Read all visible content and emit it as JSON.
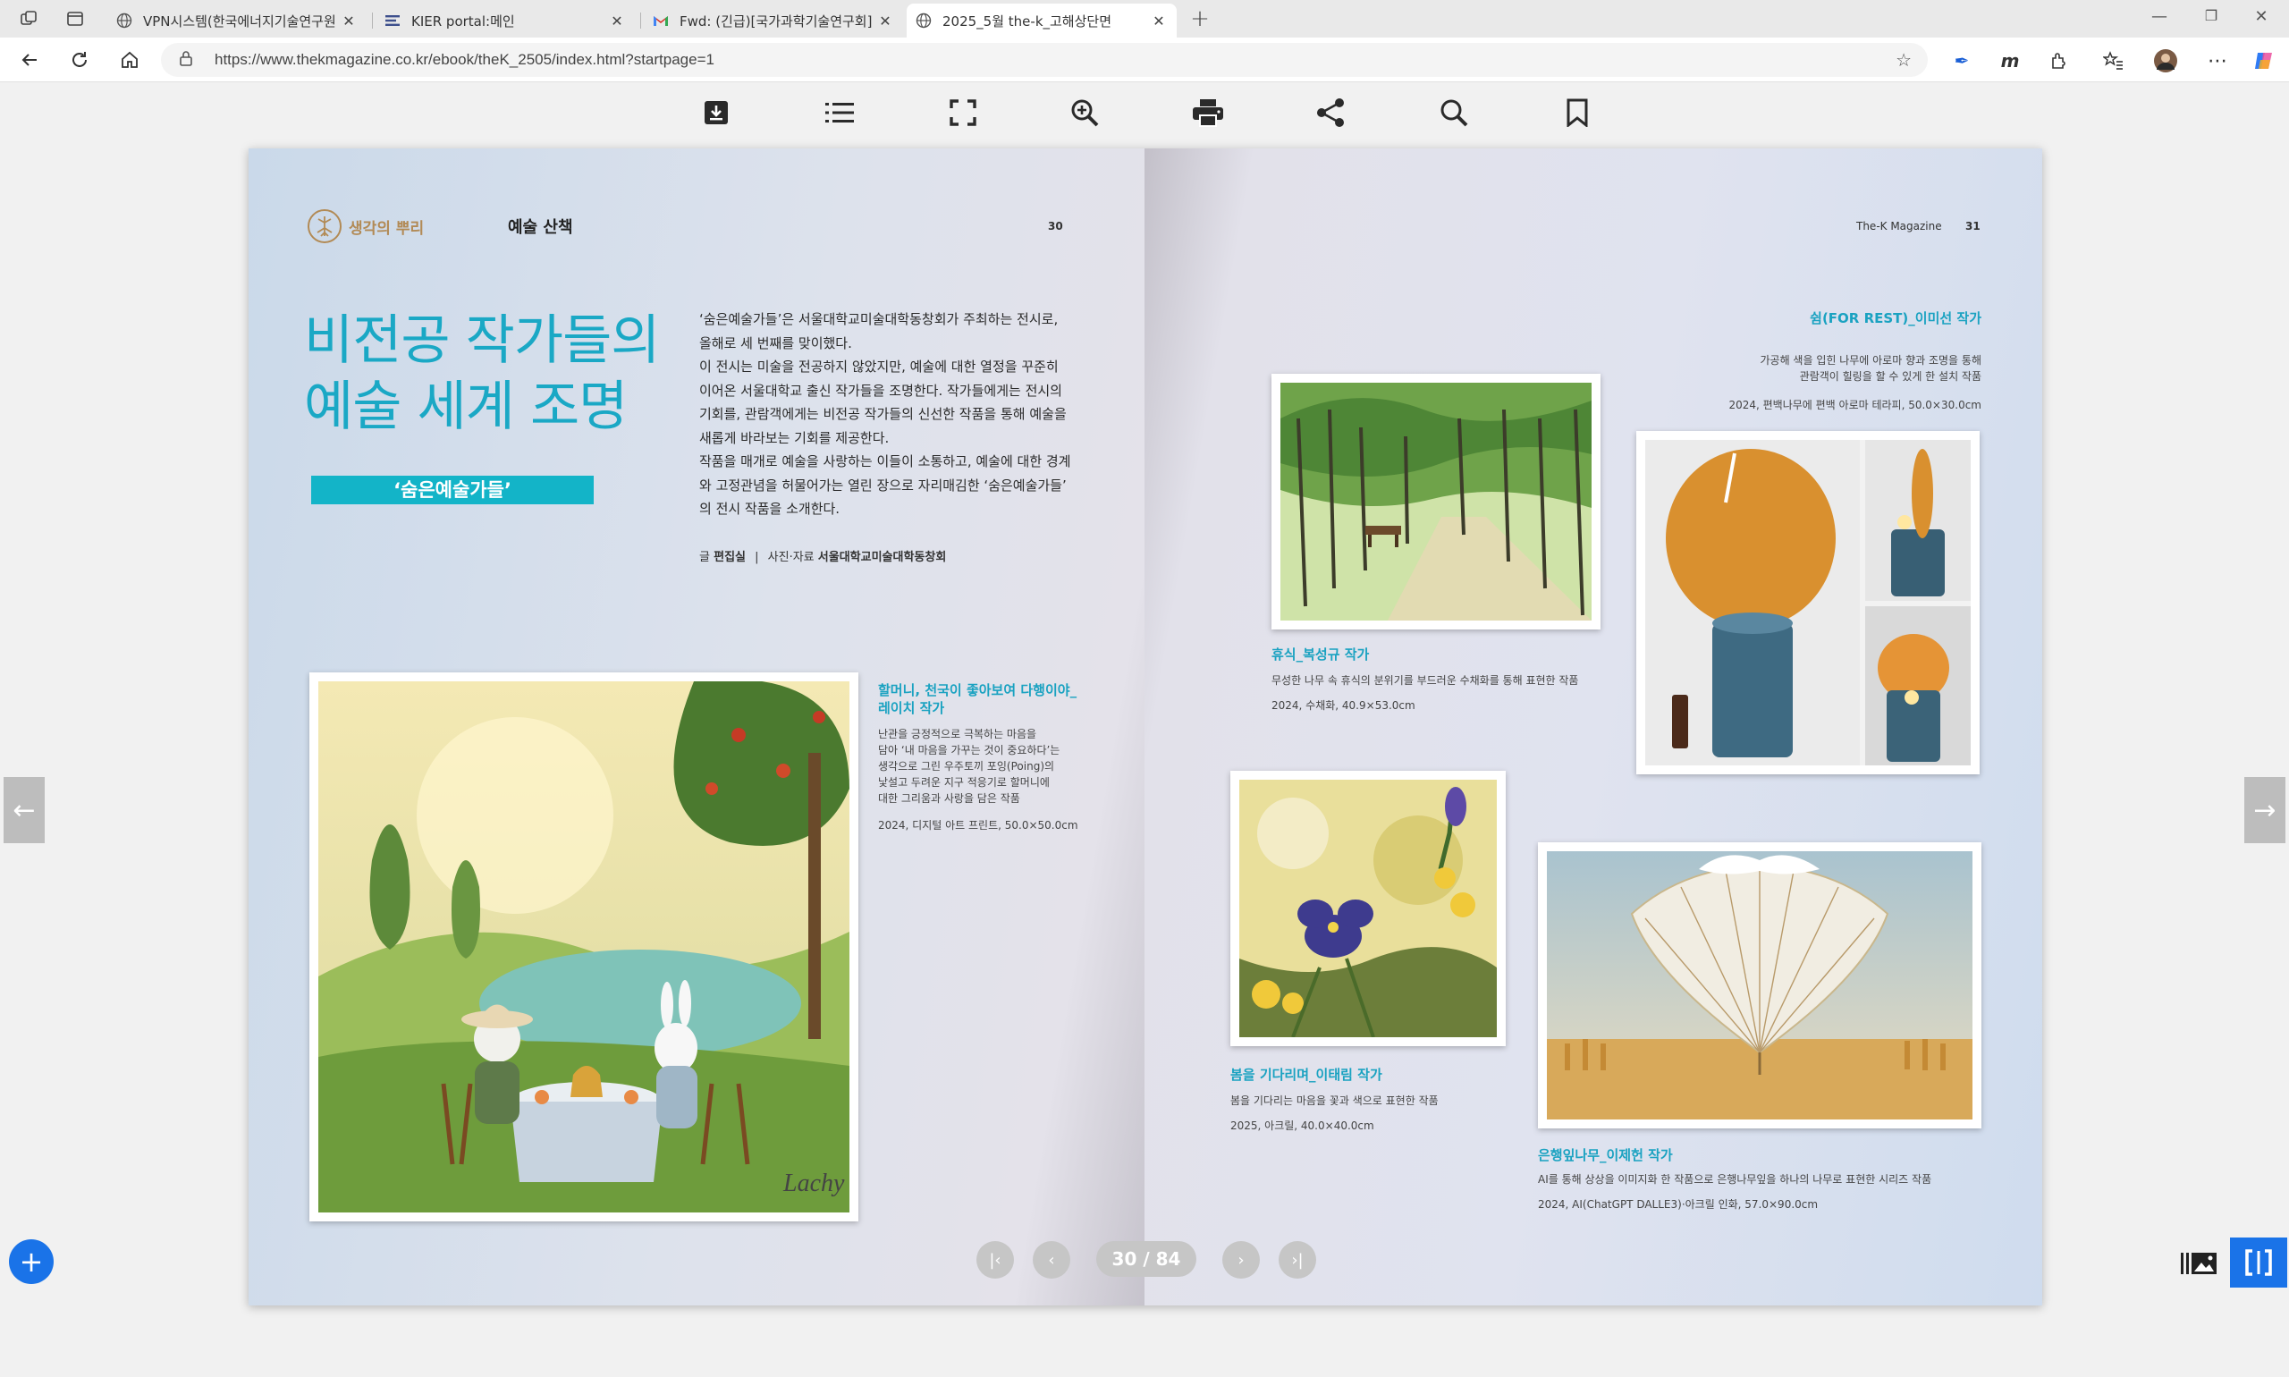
{
  "browser": {
    "tabs": [
      {
        "title": "VPN시스템(한국에너지기술연구원",
        "favicon": "globe-icon"
      },
      {
        "title": "KIER portal:메인",
        "favicon": "portal-icon"
      },
      {
        "title": "Fwd: (긴급)[국가과학기술연구회]",
        "favicon": "gmail-icon"
      },
      {
        "title": "2025_5월 the-k_고해상단면",
        "favicon": "globe-icon"
      }
    ],
    "active_tab": 3,
    "url": "https://www.thekmagazine.co.kr/ebook/theK_2505/index.html?startpage=1",
    "ext_m": "m"
  },
  "viewer": {
    "tools": [
      "download-icon",
      "list-icon",
      "fullscreen-icon",
      "zoom-in-icon",
      "print-icon",
      "share-icon",
      "search-icon",
      "bookmark-icon"
    ],
    "page_indicator": "30 / 84"
  },
  "left_page": {
    "logo_text": "생각의 뿌리",
    "section": "예술 산책",
    "page_number": "30",
    "title_line1": "비전공 작가들의",
    "title_line2": "예술 세계 조명",
    "badge": "‘숨은예술가들’",
    "intro": [
      "‘숨은예술가들’은 서울대학교미술대학동창회가 주최하는 전시로,",
      "올해로 세 번째를 맞이했다.",
      "이 전시는 미술을 전공하지 않았지만, 예술에 대한 열정을 꾸준히",
      "이어온 서울대학교 출신 작가들을 조명한다. 작가들에게는 전시의",
      "기회를, 관람객에게는 비전공 작가들의 신선한 작품을 통해 예술을",
      "새롭게 바라보는 기회를 제공한다.",
      "작품을 매개로 예술을 사랑하는 이들이 소통하고, 예술에 대한 경계",
      "와 고정관념을 허물어가는 열린 장으로 자리매김한 ‘숨은예술가들’",
      "의 전시 작품을 소개한다."
    ],
    "credit_label1": "글",
    "credit_value1": "편집실",
    "credit_sep": "|",
    "credit_label2": "사진·자료",
    "credit_value2": "서울대학교미술대학동창회",
    "artwork": {
      "title_line1": "할머니, 천국이 좋아보여 다행이야_",
      "title_line2": "레이치 작가",
      "desc": [
        "난관을 긍정적으로 극복하는 마음을",
        "담아 ‘내 마음을 가꾸는 것이 중요하다’는",
        "생각으로 그린 우주토끼 포잉(Poing)의",
        "낯설고 두려운 지구 적응기로 할머니에",
        "대한 그리움과 사랑을 담은 작품"
      ],
      "meta": "2024, 디지털 아트 프린트, 50.0×50.0cm",
      "signature": "Lachy"
    }
  },
  "right_page": {
    "magazine": "The-K Magazine",
    "page_number": "31",
    "works": [
      {
        "title": "쉼(FOR REST)_이미선 작가",
        "desc": [
          "가공해 색을 입힌 나무에 아로마 향과 조명을 통해",
          "관람객이 힐링을 할 수 있게 한 설치 작품"
        ],
        "meta": "2024, 편백나무에 편백 아로마 테라피, 50.0×30.0cm"
      },
      {
        "title": "휴식_복성규 작가",
        "desc": [
          "무성한 나무 속 휴식의 분위기를 부드러운 수채화를 통해 표현한 작품"
        ],
        "meta": "2024, 수채화, 40.9×53.0cm"
      },
      {
        "title": "봄을 기다리며_이태림 작가",
        "desc": [
          "봄을 기다리는 마음을 꽃과 색으로 표현한 작품"
        ],
        "meta": "2025, 아크릴, 40.0×40.0cm"
      },
      {
        "title": "은행잎나무_이제헌 작가",
        "desc": [
          "AI를 통해 상상을 이미지화 한 작품으로 은행나무잎을 하나의 나무로 표현한 시리즈 작품"
        ],
        "meta": "2024, AI(ChatGPT DALLE3)·아크릴 인화, 57.0×90.0cm"
      }
    ]
  },
  "colors": {
    "accent": "#1aa8c5",
    "badge": "#13b4c8",
    "logo": "#b28a55",
    "pager": "#c6c6c6",
    "fab": "#1a73e8"
  }
}
